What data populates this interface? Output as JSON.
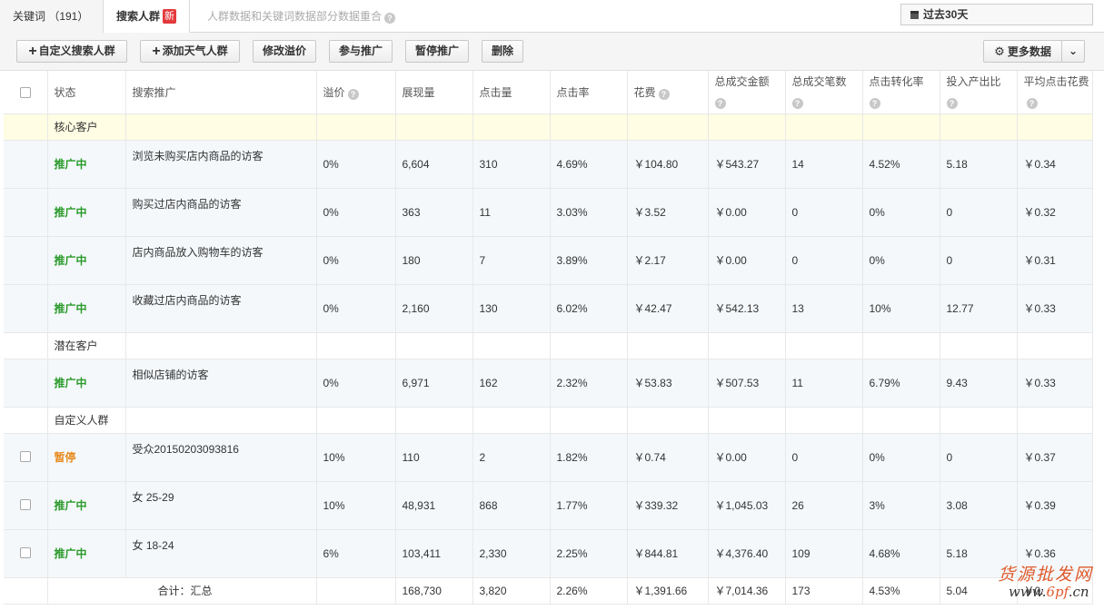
{
  "tabs": {
    "keywords": "关键词 （191）",
    "crowd": "搜索人群",
    "new_badge": "新",
    "notice": "人群数据和关键词数据部分数据重合"
  },
  "date_range": "过去30天",
  "toolbar": {
    "custom_crowd": "自定义搜索人群",
    "weather_crowd": "添加天气人群",
    "edit_premium": "修改溢价",
    "join_promo": "参与推广",
    "pause_promo": "暂停推广",
    "delete": "删除",
    "more_data": "更多数据"
  },
  "columns": {
    "status": "状态",
    "promo": "搜索推广",
    "premium": "溢价",
    "impressions": "展现量",
    "clicks": "点击量",
    "ctr": "点击率",
    "cost": "花费",
    "total_sales": "总成交金额",
    "total_orders": "总成交笔数",
    "cvr": "点击转化率",
    "roi": "投入产出比",
    "avg_cpc": "平均点击花费"
  },
  "groups": [
    {
      "label": "核心客户",
      "rows": [
        {
          "status": "推广中",
          "name": "浏览未购买店内商品的访客",
          "premium": "0%",
          "impressions": "6,604",
          "clicks": "310",
          "ctr": "4.69%",
          "cost": "￥104.80",
          "sales": "￥543.27",
          "orders": "14",
          "cvr": "4.52%",
          "roi": "5.18",
          "cpc": "￥0.34"
        },
        {
          "status": "推广中",
          "name": "购买过店内商品的访客",
          "premium": "0%",
          "impressions": "363",
          "clicks": "11",
          "ctr": "3.03%",
          "cost": "￥3.52",
          "sales": "￥0.00",
          "orders": "0",
          "cvr": "0%",
          "roi": "0",
          "cpc": "￥0.32"
        },
        {
          "status": "推广中",
          "name": "店内商品放入购物车的访客",
          "premium": "0%",
          "impressions": "180",
          "clicks": "7",
          "ctr": "3.89%",
          "cost": "￥2.17",
          "sales": "￥0.00",
          "orders": "0",
          "cvr": "0%",
          "roi": "0",
          "cpc": "￥0.31"
        },
        {
          "status": "推广中",
          "name": "收藏过店内商品的访客",
          "premium": "0%",
          "impressions": "2,160",
          "clicks": "130",
          "ctr": "6.02%",
          "cost": "￥42.47",
          "sales": "￥542.13",
          "orders": "13",
          "cvr": "10%",
          "roi": "12.77",
          "cpc": "￥0.33"
        }
      ]
    },
    {
      "label": "潜在客户",
      "rows": [
        {
          "status": "推广中",
          "name": "相似店铺的访客",
          "premium": "0%",
          "impressions": "6,971",
          "clicks": "162",
          "ctr": "2.32%",
          "cost": "￥53.83",
          "sales": "￥507.53",
          "orders": "11",
          "cvr": "6.79%",
          "roi": "9.43",
          "cpc": "￥0.33"
        }
      ]
    },
    {
      "label": "自定义人群",
      "rows": [
        {
          "status": "暂停",
          "name": "受众20150203093816",
          "premium": "10%",
          "impressions": "110",
          "clicks": "2",
          "ctr": "1.82%",
          "cost": "￥0.74",
          "sales": "￥0.00",
          "orders": "0",
          "cvr": "0%",
          "roi": "0",
          "cpc": "￥0.37"
        },
        {
          "status": "推广中",
          "name": "女 25-29",
          "premium": "10%",
          "impressions": "48,931",
          "clicks": "868",
          "ctr": "1.77%",
          "cost": "￥339.32",
          "sales": "￥1,045.03",
          "orders": "26",
          "cvr": "3%",
          "roi": "3.08",
          "cpc": "￥0.39"
        },
        {
          "status": "推广中",
          "name": "女 18-24",
          "premium": "6%",
          "impressions": "103,411",
          "clicks": "2,330",
          "ctr": "2.25%",
          "cost": "￥844.81",
          "sales": "￥4,376.40",
          "orders": "109",
          "cvr": "4.68%",
          "roi": "5.18",
          "cpc": "￥0.36"
        }
      ]
    }
  ],
  "total": {
    "label": "合计：汇总",
    "impressions": "168,730",
    "clicks": "3,820",
    "ctr": "2.26%",
    "cost": "￥1,391.66",
    "sales": "￥7,014.36",
    "orders": "173",
    "cvr": "4.53%",
    "roi": "5.04",
    "cpc": "￥0."
  },
  "watermark": {
    "line1": "货源批发网",
    "line2_a": "www.",
    "line2_b": "6pf",
    "line2_c": ".cn"
  }
}
